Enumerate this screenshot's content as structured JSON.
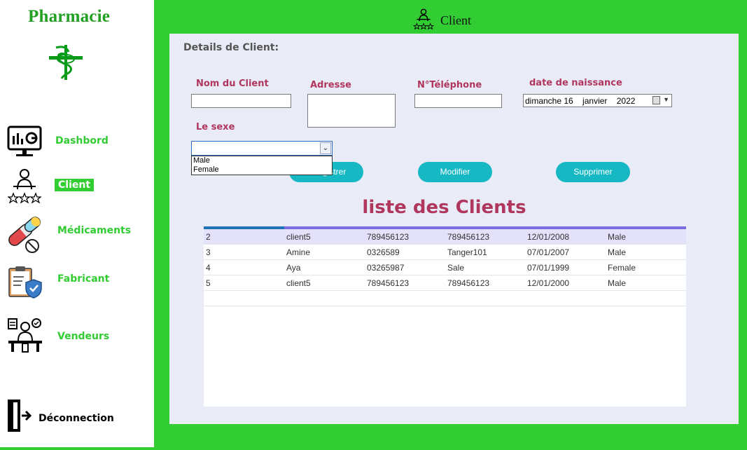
{
  "sidebar": {
    "brand": "Pharmacie",
    "items": [
      {
        "label": "Dashbord",
        "icon": "dashboard-monitor-icon"
      },
      {
        "label": "Client",
        "icon": "client-person-stars-icon",
        "active": true
      },
      {
        "label": "Médicaments",
        "icon": "medicine-pills-icon"
      },
      {
        "label": "Fabricant",
        "icon": "clipboard-shield-icon"
      },
      {
        "label": "Vendeurs",
        "icon": "seller-people-icon"
      }
    ],
    "logout_label": "Déconnection",
    "logout_icon": "logout-door-icon"
  },
  "header": {
    "title": "Client",
    "icon": "client-person-stars-icon"
  },
  "form": {
    "section_title": "Details de Client:",
    "nom_label": "Nom du Client",
    "nom_value": "",
    "adresse_label": "Adresse",
    "adresse_value": "",
    "telephone_label": "N°Téléphone",
    "telephone_value": "",
    "date_label": "date de naissance",
    "date_value": "dimanche 16    janvier    2022",
    "sexe_label": "Le sexe",
    "sexe_value": "",
    "sexe_options": [
      "Male",
      "Female"
    ],
    "enregistrer_partial": "gistrer",
    "modifier_label": "Modifier",
    "supprimer_label": "Supprimer"
  },
  "list": {
    "title": "liste des Clients",
    "rows": [
      [
        "2",
        "client5",
        "789456123",
        "789456123",
        "12/01/2008",
        "Male"
      ],
      [
        "3",
        "Amine",
        "0326589",
        "Tanger101",
        "07/01/2007",
        "Male"
      ],
      [
        "4",
        "Aya",
        "03265987",
        "Sale",
        "07/01/1999",
        "Female"
      ],
      [
        "5",
        "client5",
        "789456123",
        "789456123",
        "12/01/2000",
        "Male"
      ]
    ]
  },
  "colors": {
    "green": "#32cd32",
    "brand_green": "#22a022",
    "label_pink": "#b0365e",
    "button_teal": "#16b8c3",
    "panel_bg": "#e9ecf7"
  }
}
